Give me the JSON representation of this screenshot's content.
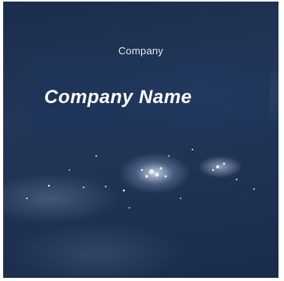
{
  "card": {
    "eyebrow": "Company",
    "title": "Company Name"
  }
}
